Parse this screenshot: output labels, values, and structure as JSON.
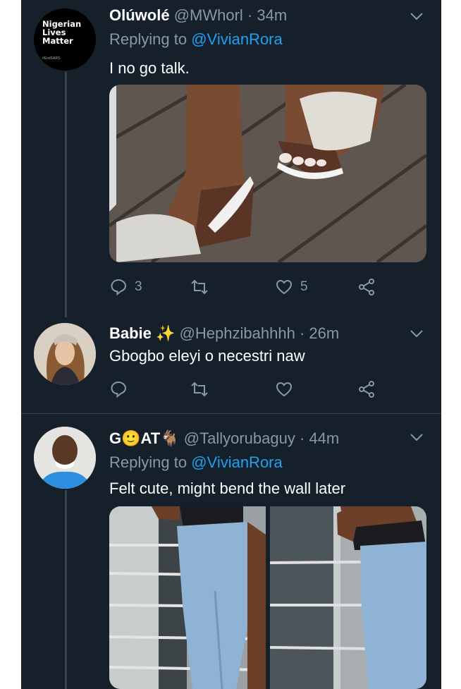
{
  "tweets": [
    {
      "name": "Olúwolé",
      "handle": "@MWhorl",
      "sep": "·",
      "time": "34m",
      "replying_prefix": "Replying to",
      "replying_handle": "@VivianRora",
      "text": "I no go talk.",
      "avatar_text": {
        "line1": "Nigerian",
        "line2": "Lives",
        "line3": "Matter",
        "tag": "#EndSARS"
      },
      "stats": {
        "replies": "3",
        "retweets": "",
        "likes": "5"
      }
    },
    {
      "name": "Babie",
      "name_emoji": "✨",
      "handle": "@Hephzibahhhh",
      "sep": "·",
      "time": "26m",
      "text": "Gbogbo eleyi o necestri naw",
      "stats": {
        "replies": "",
        "retweets": "",
        "likes": ""
      }
    },
    {
      "name_part1": "G",
      "name_emoji1": "🙂",
      "name_part2": "AT",
      "name_emoji2": "🐐",
      "handle": "@Tallyorubaguy",
      "sep": "·",
      "time": "44m",
      "replying_prefix": "Replying to",
      "replying_handle": "@VivianRora",
      "text": "Felt cute, might bend the wall later"
    }
  ],
  "icons": [
    "reply-icon",
    "retweet-icon",
    "like-icon",
    "share-icon",
    "chevron-down-icon"
  ],
  "colors": {
    "background": "#15202b",
    "text": "#ffffff",
    "muted": "#8899a6",
    "link": "#1da1f2",
    "divider": "#38444d"
  }
}
